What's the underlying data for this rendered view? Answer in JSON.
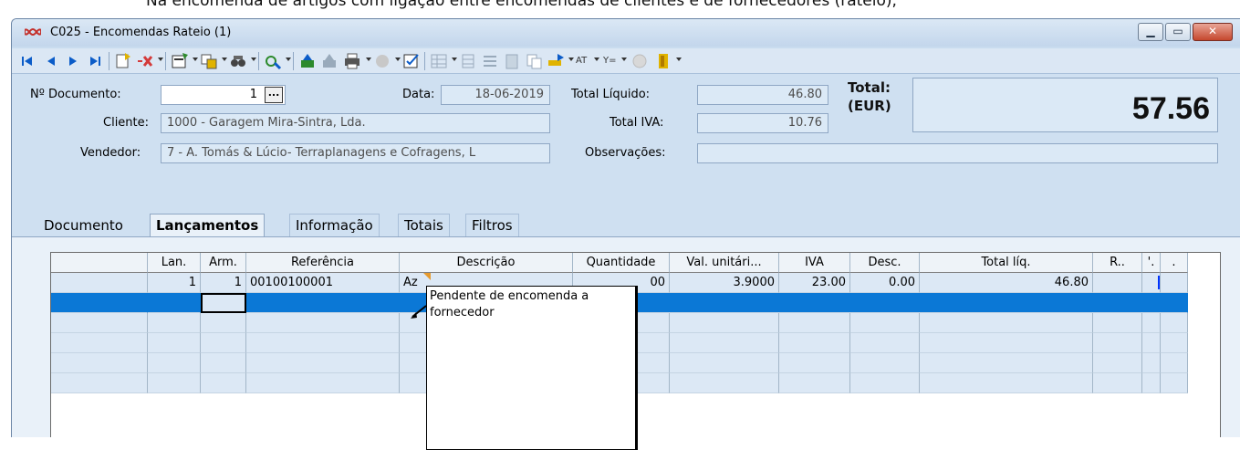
{
  "caption": "Na encomenda de artigos com ligação entre encomendas de clientes e de fornecedores (rateio);",
  "window": {
    "title": "C025 - Encomendas Rateio (1)",
    "app_icon": "infinity-icon",
    "controls": {
      "minimize": "minimize-icon",
      "maximize": "maximize-icon",
      "close": "close-icon"
    }
  },
  "toolbar": {
    "icons": [
      "first-record-icon",
      "previous-record-icon",
      "next-record-icon",
      "last-record-icon",
      "new-document-icon",
      "cancel-icon",
      "edit-icon",
      "transfer-icon",
      "find-icon",
      "tools-icon",
      "save-icon",
      "save-disabled-icon",
      "print-icon",
      "export-icon",
      "check-icon",
      "table-icon",
      "columns-icon",
      "list-icon",
      "clipboard-icon",
      "copy-icon",
      "highlight-icon",
      "at-icon",
      "filter-icon",
      "globe-icon",
      "exit-icon"
    ],
    "at_text": "AT",
    "filter_text": "Y=",
    "colors": {
      "accent": "#0b5cc8",
      "warning": "#e0b300",
      "danger": "#d43a3a",
      "success": "#2c8a2c"
    }
  },
  "form": {
    "doc_number_label": "Nº Documento:",
    "doc_number": "1",
    "dots_label": "...",
    "date_label": "Data:",
    "date": "18-06-2019",
    "client_label": "Cliente:",
    "client": "1000 - Garagem Mira-Sintra, Lda.",
    "seller_label": "Vendedor:",
    "seller": "7 - A. Tomás & Lúcio- Terraplanagens e Cofragens, L",
    "net_total_label": "Total Líquido:",
    "net_total": "46.80",
    "vat_total_label": "Total IVA:",
    "vat_total": "10.76",
    "notes_label": "Observações:",
    "notes": "",
    "total_label": "Total:",
    "currency_label": "(EUR)",
    "total": "57.56"
  },
  "tabs": [
    {
      "label": "Documento",
      "active": false
    },
    {
      "label": "Lançamentos",
      "active": true
    },
    {
      "label": "Informação",
      "active": false
    },
    {
      "label": "Totais",
      "active": false
    },
    {
      "label": "Filtros",
      "active": false
    }
  ],
  "grid": {
    "columns": [
      "",
      "Lan.",
      "Arm.",
      "Referência",
      "Descrição",
      "Quantidade",
      "Val. unitári...",
      "IVA",
      "Desc.",
      "Total líq.",
      "R..",
      "'.",
      "."
    ],
    "rows": [
      {
        "lan": "1",
        "arm": "1",
        "ref": "00100100001",
        "desc": "Az",
        "qty": "00",
        "unit": "3.9000",
        "iva": "23.00",
        "disc": "0.00",
        "total": "46.80",
        "r": "",
        "mark": "|",
        "dot": ""
      }
    ],
    "tooltip": "Pendente de encomenda a fornecedor"
  }
}
